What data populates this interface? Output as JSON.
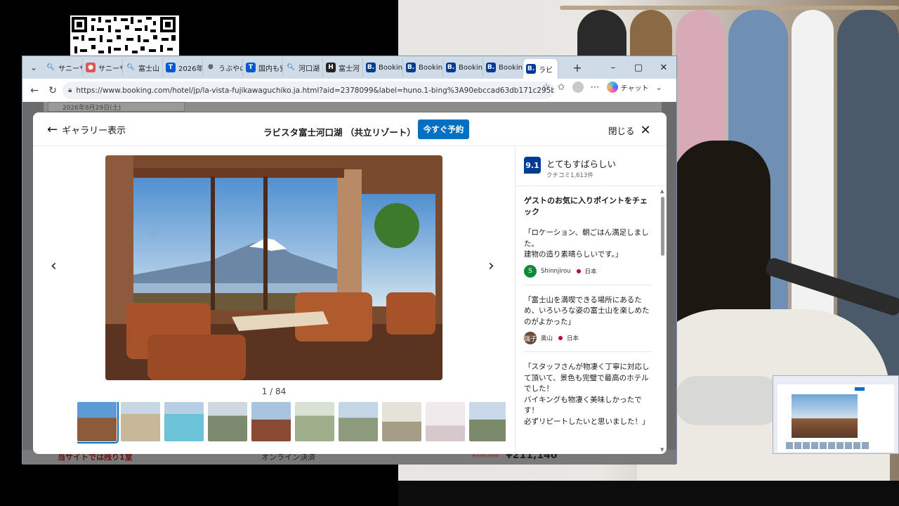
{
  "browser": {
    "tabs": [
      {
        "label": "サニーサ",
        "icon": "search-icon",
        "color": "#5a8fd4"
      },
      {
        "label": "サニーサ",
        "icon": "sushi-icon",
        "color": "#d55"
      },
      {
        "label": "富士山",
        "icon": "search-icon",
        "color": "#5a8fd4"
      },
      {
        "label": "2026年",
        "icon": "T",
        "color": "#0b57d0"
      },
      {
        "label": "うぶやの",
        "icon": "globe-icon",
        "color": "#444"
      },
      {
        "label": "国内も安",
        "icon": "T",
        "color": "#0b57d0"
      },
      {
        "label": "河口湖",
        "icon": "search-icon",
        "color": "#5a8fd4"
      },
      {
        "label": "富士河",
        "icon": "H",
        "color": "#222"
      },
      {
        "label": "Bookin",
        "icon": "B.",
        "color": "#003b95"
      },
      {
        "label": "Bookin",
        "icon": "B.",
        "color": "#003b95"
      },
      {
        "label": "Bookin",
        "icon": "B.",
        "color": "#003b95"
      },
      {
        "label": "Bookin",
        "icon": "B.",
        "color": "#003b95"
      },
      {
        "label": "ラビ",
        "icon": "B.",
        "color": "#003b95",
        "active": true
      }
    ],
    "url": "https://www.booking.com/hotel/jp/la-vista-fujikawaguchiko.ja.html?aid=2378099&label=huno.1-bing%3A90ebccad63db171c295ba63...",
    "chat_label": "チャット"
  },
  "page_bg": {
    "date_text": "2026年8月29日(土)",
    "left_bottom_text": "当サイトでは残り1室",
    "mid_bottom_text": "オンライン決済",
    "old_price": "¥234,600",
    "price": "¥211,140"
  },
  "modal": {
    "back_label": "ギャラリー表示",
    "hotel_title": "ラビスタ富士河口湖 （共立リゾート）",
    "book_label": "今すぐ予約",
    "close_label": "閉じる",
    "counter": "1 / 84"
  },
  "reviews": {
    "score": "9.1",
    "rating_label": "とてもすばらしい",
    "count_label": "クチコミ1,613件",
    "heading": "ゲストのお気に入りポイントをチェック",
    "items": [
      {
        "text": "「ロケーション、朝ごはん満足しました。\n建物の造り素晴らしいです。」",
        "name": "Shinnjirou",
        "country": "日本",
        "avatar": "S",
        "avatar_color": "#0b8a3a"
      },
      {
        "text": "「富士山を満喫できる場所にあるため、いろいろな姿の富士山を楽しめたのがよかった」",
        "name": "奥山",
        "country": "日本",
        "avatar": "瑞子",
        "avatar_color": "#6b4a3a"
      },
      {
        "text": "「スタッフさんが物凄く丁寧に対応して頂いて、景色も完璧で最高のホテルでした！\nバイキングも物凄く美味しかったです！\n必ずリピートしたいと思いました！」",
        "name": "",
        "country": "",
        "avatar": "",
        "avatar_color": "#999"
      }
    ]
  },
  "colors": {
    "booking_blue": "#0071c2",
    "badge_blue": "#003b95"
  }
}
